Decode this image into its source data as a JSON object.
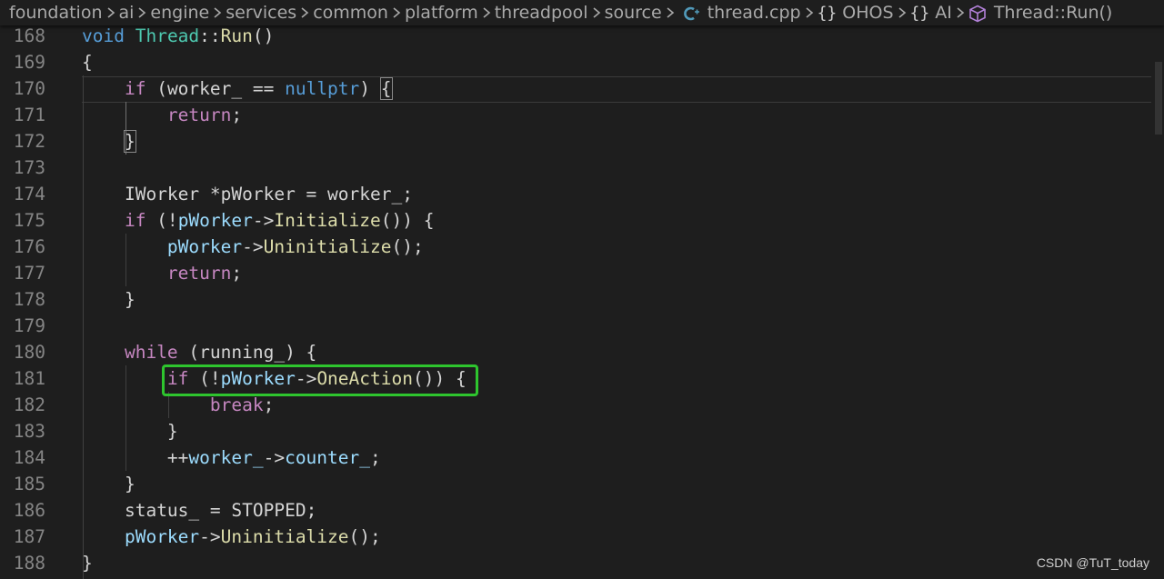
{
  "breadcrumb": {
    "items": [
      {
        "label": "foundation"
      },
      {
        "label": "ai"
      },
      {
        "label": "engine"
      },
      {
        "label": "services"
      },
      {
        "label": "common"
      },
      {
        "label": "platform"
      },
      {
        "label": "threadpool"
      },
      {
        "label": "source"
      },
      {
        "label": "thread.cpp",
        "icon": "cpp-file-icon"
      },
      {
        "label": "OHOS",
        "icon": "namespace-icon",
        "glyph": "{}"
      },
      {
        "label": "AI",
        "icon": "namespace-icon",
        "glyph": "{}"
      },
      {
        "label": "Thread::Run()",
        "icon": "method-cube-icon"
      }
    ]
  },
  "editor": {
    "line_numbers": [
      "168",
      "169",
      "170",
      "171",
      "172",
      "173",
      "174",
      "175",
      "176",
      "177",
      "178",
      "179",
      "180",
      "181",
      "182",
      "183",
      "184",
      "185",
      "186",
      "187",
      "188"
    ],
    "tokens": {
      "l168": [
        "void",
        "Thread",
        "::",
        "Run",
        "()"
      ],
      "l169": [
        "{"
      ],
      "l170": [
        "if",
        " (",
        "worker_",
        " == ",
        "nullptr",
        ") ",
        "{"
      ],
      "l171": [
        "return",
        ";"
      ],
      "l172": [
        "}"
      ],
      "l174": [
        "IWorker ",
        "*pWorker",
        " = ",
        "worker_",
        ";"
      ],
      "l175": [
        "if",
        " (!",
        "pWorker",
        "->",
        "Initialize",
        "()) {"
      ],
      "l176": [
        "pWorker",
        "->",
        "Uninitialize",
        "();"
      ],
      "l177": [
        "return",
        ";"
      ],
      "l178": [
        "}"
      ],
      "l180": [
        "while",
        " (",
        "running_",
        ") {"
      ],
      "l181": [
        "if",
        " (!",
        "pWorker",
        "->",
        "OneAction",
        "()) {"
      ],
      "l182": [
        "break",
        ";"
      ],
      "l183": [
        "}"
      ],
      "l184": [
        "++",
        "worker_",
        "->",
        "counter_",
        ";"
      ],
      "l185": [
        "}"
      ],
      "l186": [
        "status_",
        " = ",
        "STOPPED",
        ";"
      ],
      "l187": [
        "pWorker",
        "->",
        "Uninitialize",
        "();"
      ],
      "l188": [
        "}"
      ]
    }
  },
  "watermark": "CSDN @TuT_today",
  "colors": {
    "background": "#1e1e1e",
    "keyword_blue": "#569cd6",
    "keyword_purple": "#c586c0",
    "function": "#dcdcaa",
    "type": "#4ec9b0",
    "variable": "#9cdcfe",
    "highlight_box": "#2ec52e"
  }
}
